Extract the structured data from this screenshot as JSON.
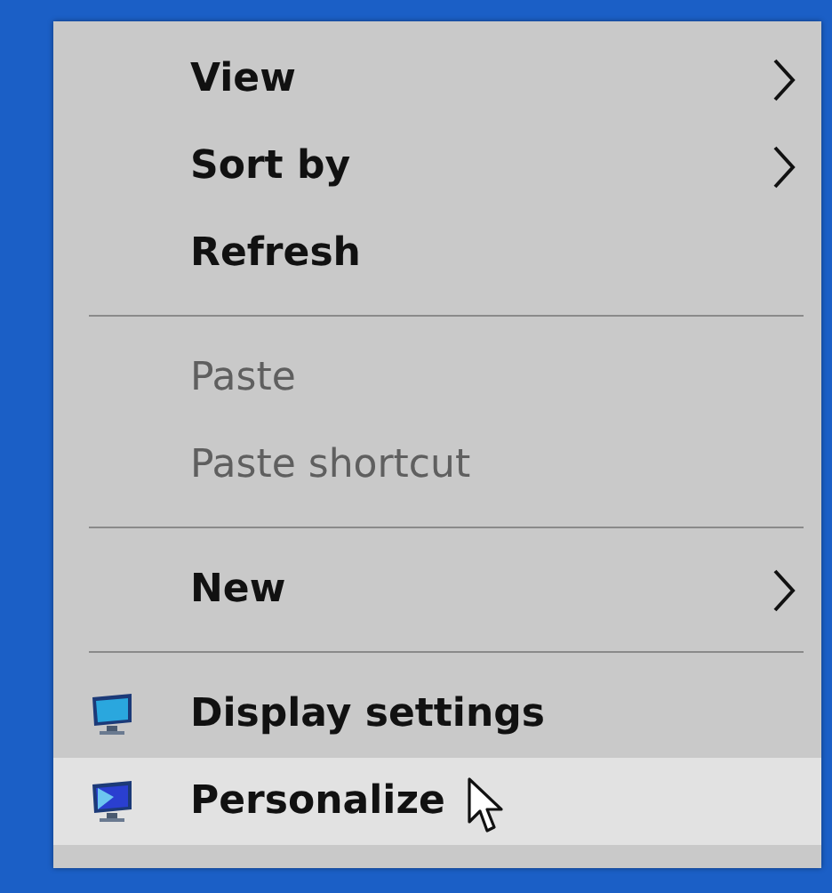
{
  "menu": {
    "items": [
      {
        "kind": "item",
        "label": "View",
        "disabled": false,
        "submenu": true,
        "selected": false
      },
      {
        "kind": "item",
        "label": "Sort by",
        "disabled": false,
        "submenu": true,
        "selected": false
      },
      {
        "kind": "item",
        "label": "Refresh",
        "disabled": false,
        "submenu": false,
        "selected": false
      },
      {
        "kind": "separator"
      },
      {
        "kind": "item",
        "label": "Paste",
        "disabled": true,
        "submenu": false,
        "selected": false
      },
      {
        "kind": "item",
        "label": "Paste shortcut",
        "disabled": true,
        "submenu": false,
        "selected": false
      },
      {
        "kind": "separator"
      },
      {
        "kind": "item",
        "label": "New",
        "disabled": false,
        "submenu": true,
        "selected": false
      },
      {
        "kind": "separator"
      },
      {
        "kind": "monitor",
        "label": "Display settings",
        "disabled": false,
        "submenu": false,
        "selected": false
      },
      {
        "kind": "theme",
        "label": "Personalize",
        "disabled": false,
        "submenu": false,
        "selected": true
      }
    ]
  }
}
